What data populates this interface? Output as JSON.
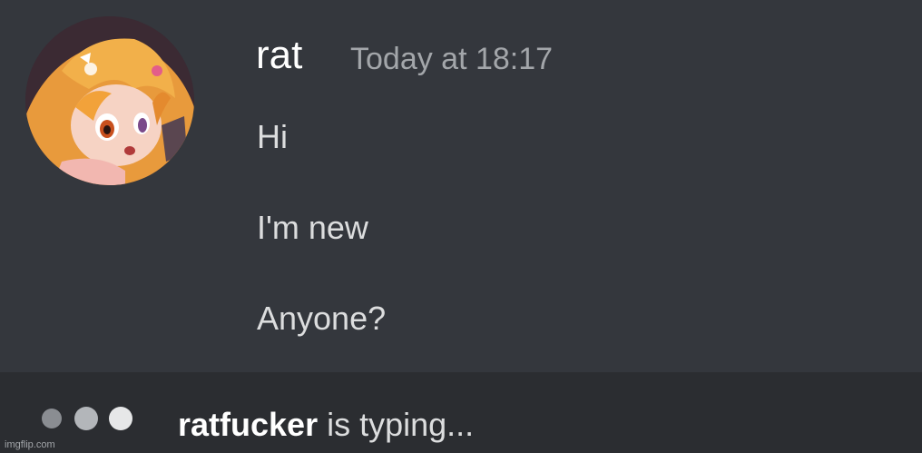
{
  "message": {
    "username": "rat",
    "timestamp": "Today at 18:17",
    "lines": [
      "Hi",
      "I'm new",
      "Anyone?"
    ]
  },
  "typing": {
    "user": "ratfucker",
    "suffix": " is typing..."
  },
  "watermark": "imgflip.com",
  "colors": {
    "background": "#34373d",
    "typing_bar": "#2b2d31",
    "username": "#ffffff",
    "timestamp": "#a3a6aa",
    "message_text": "#dcddde"
  },
  "icons": {
    "avatar": "anime-character-avatar",
    "typing_indicator": "typing-dots-icon"
  }
}
